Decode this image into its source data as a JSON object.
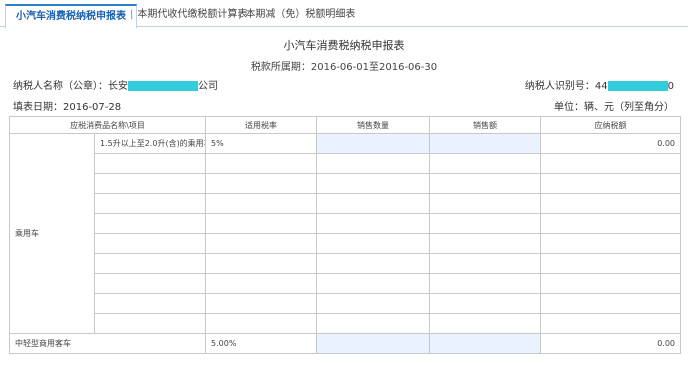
{
  "tabs": [
    {
      "label": "小汽车消费税纳税申报表",
      "active": true
    },
    {
      "label": "本期代收代缴税额计算表",
      "active": false
    },
    {
      "label": "本期减（免）税额明细表",
      "active": false
    }
  ],
  "form": {
    "title": "小汽车消费税纳税申报表",
    "period": "税款所属期：2016-06-01至2016-06-30",
    "taxpayer_name_label": "纳税人名称（公章）：长安",
    "taxpayer_name_suffix": "公司",
    "taxpayer_id_label": "纳税人识别号：44",
    "taxpayer_id_suffix": "0",
    "fill_date": "填表日期：2016-07-28",
    "unit": "单位：辆、元（列至角分）"
  },
  "table": {
    "headers": [
      "应税消费品名称\\项目",
      "适用税率",
      "销售数量",
      "销售额",
      "应纳税额"
    ],
    "rows": [
      {
        "category": "乘用车",
        "subitem": "1.5升以上至2.0升(含)的乘用车",
        "rate": "5%",
        "amount_tax": "0.00"
      },
      {
        "subitem": "",
        "rate": "",
        "amount_tax": ""
      },
      {
        "subitem": "",
        "rate": "",
        "amount_tax": ""
      },
      {
        "subitem": "",
        "rate": "",
        "amount_tax": ""
      },
      {
        "subitem": "",
        "rate": "",
        "amount_tax": ""
      },
      {
        "subitem": "",
        "rate": "",
        "amount_tax": ""
      },
      {
        "subitem": "",
        "rate": "",
        "amount_tax": ""
      },
      {
        "subitem": "",
        "rate": "",
        "amount_tax": ""
      },
      {
        "subitem": "",
        "rate": "",
        "amount_tax": ""
      },
      {
        "subitem": "",
        "rate": "",
        "amount_tax": ""
      }
    ],
    "bottom_row": {
      "category": "中轻型商用客车",
      "rate": "5.00%",
      "amount_tax": "0.00"
    }
  },
  "colors": {
    "tab_accent": "#2f7fd0",
    "input_bg": "#eaf2fd",
    "redaction": "#33ccdd"
  }
}
